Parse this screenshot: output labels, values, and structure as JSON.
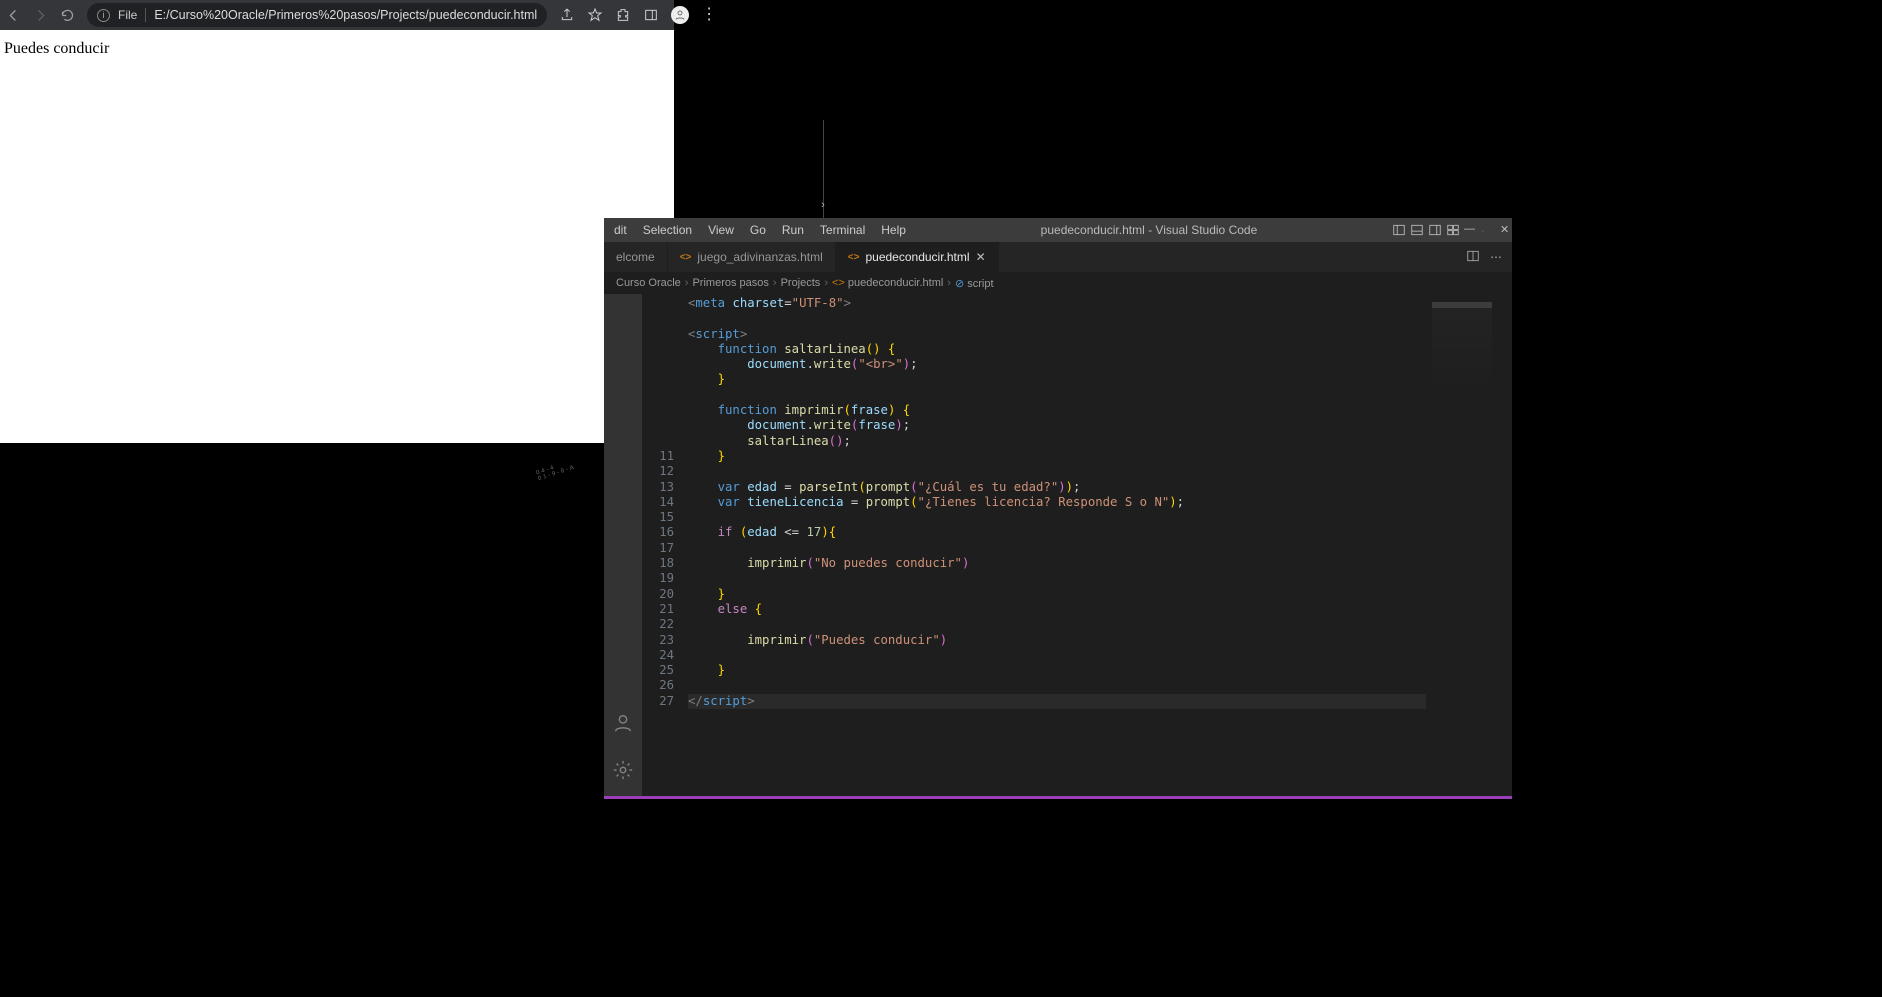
{
  "browser": {
    "url_scheme_label": "File",
    "url": "E:/Curso%20Oracle/Primeros%20pasos/Projects/puedeconducir.html",
    "page_text": "Puedes conducir"
  },
  "vscode": {
    "menu": [
      "dit",
      "Selection",
      "View",
      "Go",
      "Run",
      "Terminal",
      "Help"
    ],
    "title": "puedeconducir.html - Visual Studio Code",
    "tabs": [
      {
        "label": "elcome",
        "icon": "",
        "active": false,
        "close": false
      },
      {
        "label": "juego_adivinanzas.html",
        "icon": "<>",
        "active": false,
        "close": false
      },
      {
        "label": "puedeconducir.html",
        "icon": "<>",
        "active": true,
        "close": true
      }
    ],
    "breadcrumb": [
      "Curso Oracle",
      "Primeros pasos",
      "Projects",
      "puedeconducir.html",
      "script"
    ],
    "line_start": 11,
    "code_lines": [
      {
        "n": "",
        "html": "<span class='ang'>&lt;</span><span class='tag'>meta</span> <span class='attr'>charset</span><span class='pn'>=</span><span class='str'>\"UTF-8\"</span><span class='ang'>&gt;</span>"
      },
      {
        "n": "",
        "html": ""
      },
      {
        "n": "",
        "html": "<span class='ang'>&lt;</span><span class='tag'>script</span><span class='ang'>&gt;</span>"
      },
      {
        "n": "",
        "html": "    <span class='kw'>function</span> <span class='fn'>saltarLinea</span><span class='brkt'>(</span><span class='brkt'>)</span> <span class='brkt'>{</span>"
      },
      {
        "n": "",
        "html": "        <span class='var'>document</span><span class='pn'>.</span><span class='fn'>write</span><span class='brkt2'>(</span><span class='str'>\"&lt;br&gt;\"</span><span class='brkt2'>)</span><span class='pn'>;</span>"
      },
      {
        "n": "",
        "html": "    <span class='brkt'>}</span>"
      },
      {
        "n": "",
        "html": ""
      },
      {
        "n": "",
        "html": "    <span class='kw'>function</span> <span class='fn'>imprimir</span><span class='brkt'>(</span><span class='var'>frase</span><span class='brkt'>)</span> <span class='brkt'>{</span>"
      },
      {
        "n": "",
        "html": "        <span class='var'>document</span><span class='pn'>.</span><span class='fn'>write</span><span class='brkt2'>(</span><span class='var'>frase</span><span class='brkt2'>)</span><span class='pn'>;</span>"
      },
      {
        "n": "",
        "html": "        <span class='fn'>saltarLinea</span><span class='brkt2'>(</span><span class='brkt2'>)</span><span class='pn'>;</span>"
      },
      {
        "n": "11",
        "html": "    <span class='brkt'>}</span>"
      },
      {
        "n": "12",
        "html": ""
      },
      {
        "n": "13",
        "html": "    <span class='kw'>var</span> <span class='var'>edad</span> <span class='pn'>=</span> <span class='fn'>parseInt</span><span class='brkt'>(</span><span class='fn'>prompt</span><span class='brkt2'>(</span><span class='str'>\"¿Cuál es tu edad?\"</span><span class='brkt2'>)</span><span class='brkt'>)</span><span class='pn'>;</span>"
      },
      {
        "n": "14",
        "html": "    <span class='kw'>var</span> <span class='var'>tieneLicencia</span> <span class='pn'>=</span> <span class='fn'>prompt</span><span class='brkt'>(</span><span class='str'>\"¿Tienes licencia? Responde S o N\"</span><span class='brkt'>)</span><span class='pn'>;</span>"
      },
      {
        "n": "15",
        "html": ""
      },
      {
        "n": "16",
        "html": "    <span class='kw2'>if</span> <span class='brkt'>(</span><span class='var'>edad</span> <span class='pn'>&lt;=</span> <span class='num'>17</span><span class='brkt'>)</span><span class='brkt'>{</span>"
      },
      {
        "n": "17",
        "html": ""
      },
      {
        "n": "18",
        "html": "        <span class='fn'>imprimir</span><span class='brkt2'>(</span><span class='str'>\"No puedes conducir\"</span><span class='brkt2'>)</span>"
      },
      {
        "n": "19",
        "html": ""
      },
      {
        "n": "20",
        "html": "    <span class='brkt'>}</span>"
      },
      {
        "n": "21",
        "html": "    <span class='kw2'>else</span> <span class='brkt'>{</span>"
      },
      {
        "n": "22",
        "html": ""
      },
      {
        "n": "23",
        "html": "        <span class='fn'>imprimir</span><span class='brkt2'>(</span><span class='str'>\"Puedes conducir\"</span><span class='brkt2'>)</span>"
      },
      {
        "n": "24",
        "html": ""
      },
      {
        "n": "25",
        "html": "    <span class='brkt'>}</span>"
      },
      {
        "n": "26",
        "html": ""
      },
      {
        "n": "27",
        "html": "<span class='ang'>&lt;/</span><span class='tag'>script</span><span class='ang'>&gt;</span>"
      }
    ]
  }
}
